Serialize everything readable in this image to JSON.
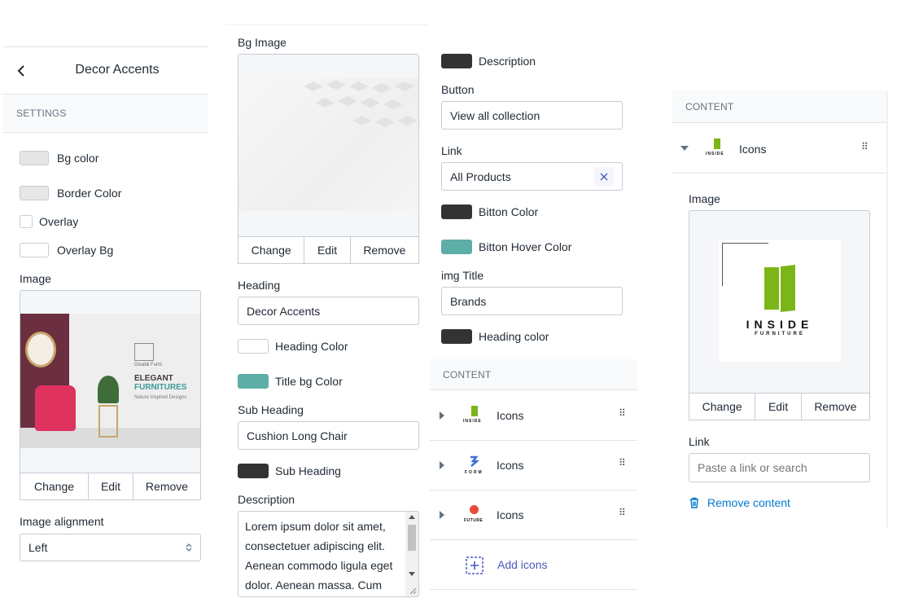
{
  "colors": {
    "swatch_dark": "#333333",
    "swatch_teal": "#5eaea8",
    "swatch_light": "#e6e6e6",
    "accent_link": "#4959bd",
    "remove_blue": "#007ace",
    "logo_green": "#7cb518"
  },
  "panel1": {
    "back_icon": "chevron-left-icon",
    "title": "Decor Accents",
    "section": "SETTINGS",
    "bg_color_label": "Bg color",
    "border_color_label": "Border Color",
    "overlay_label": "Overlay",
    "overlay_bg_label": "Overlay Bg",
    "image_label": "Image",
    "preview": {
      "brand": "Givaldi Furni",
      "line1": "ELEGANT",
      "line2": "FURNITURES",
      "tagline": "Nature Inspired Designs"
    },
    "change": "Change",
    "edit": "Edit",
    "remove": "Remove",
    "alignment_label": "Image alignment",
    "alignment_value": "Left"
  },
  "panel2": {
    "bg_image_label": "Bg Image",
    "change": "Change",
    "edit": "Edit",
    "remove": "Remove",
    "heading_label": "Heading",
    "heading_value": "Decor Accents",
    "heading_color_label": "Heading Color",
    "title_bg_color_label": "Title bg Color",
    "sub_heading_label": "Sub Heading",
    "sub_heading_value": "Cushion Long Chair",
    "sub_heading_color_label": "Sub Heading",
    "description_label": "Description",
    "description_text": "Lorem ipsum dolor sit amet, consectetuer adipiscing elit. Aenean commodo ligula eget dolor. Aenean massa. Cum"
  },
  "panel3": {
    "description_color_label": "Description",
    "button_label": "Button",
    "button_value": "View all collection",
    "link_label": "Link",
    "link_value": "All Products",
    "button_color_label": "Bitton Color",
    "button_hover_color_label": "Bitton Hover Color",
    "img_title_label": "img Title",
    "img_title_value": "Brands",
    "heading_color_label": "Heading color",
    "content_section": "CONTENT",
    "items": [
      {
        "label": "Icons",
        "logo": "INSIDE"
      },
      {
        "label": "Icons",
        "logo": "FORM"
      },
      {
        "label": "Icons",
        "logo": "FUTURE"
      }
    ],
    "add_icons": "Add icons"
  },
  "panel4": {
    "content_section": "CONTENT",
    "item_label": "Icons",
    "image_label": "Image",
    "logo_main": "INSIDE",
    "logo_sub": "FURNITURE",
    "change": "Change",
    "edit": "Edit",
    "remove": "Remove",
    "link_label": "Link",
    "link_placeholder": "Paste a link or search",
    "remove_content": "Remove content"
  }
}
